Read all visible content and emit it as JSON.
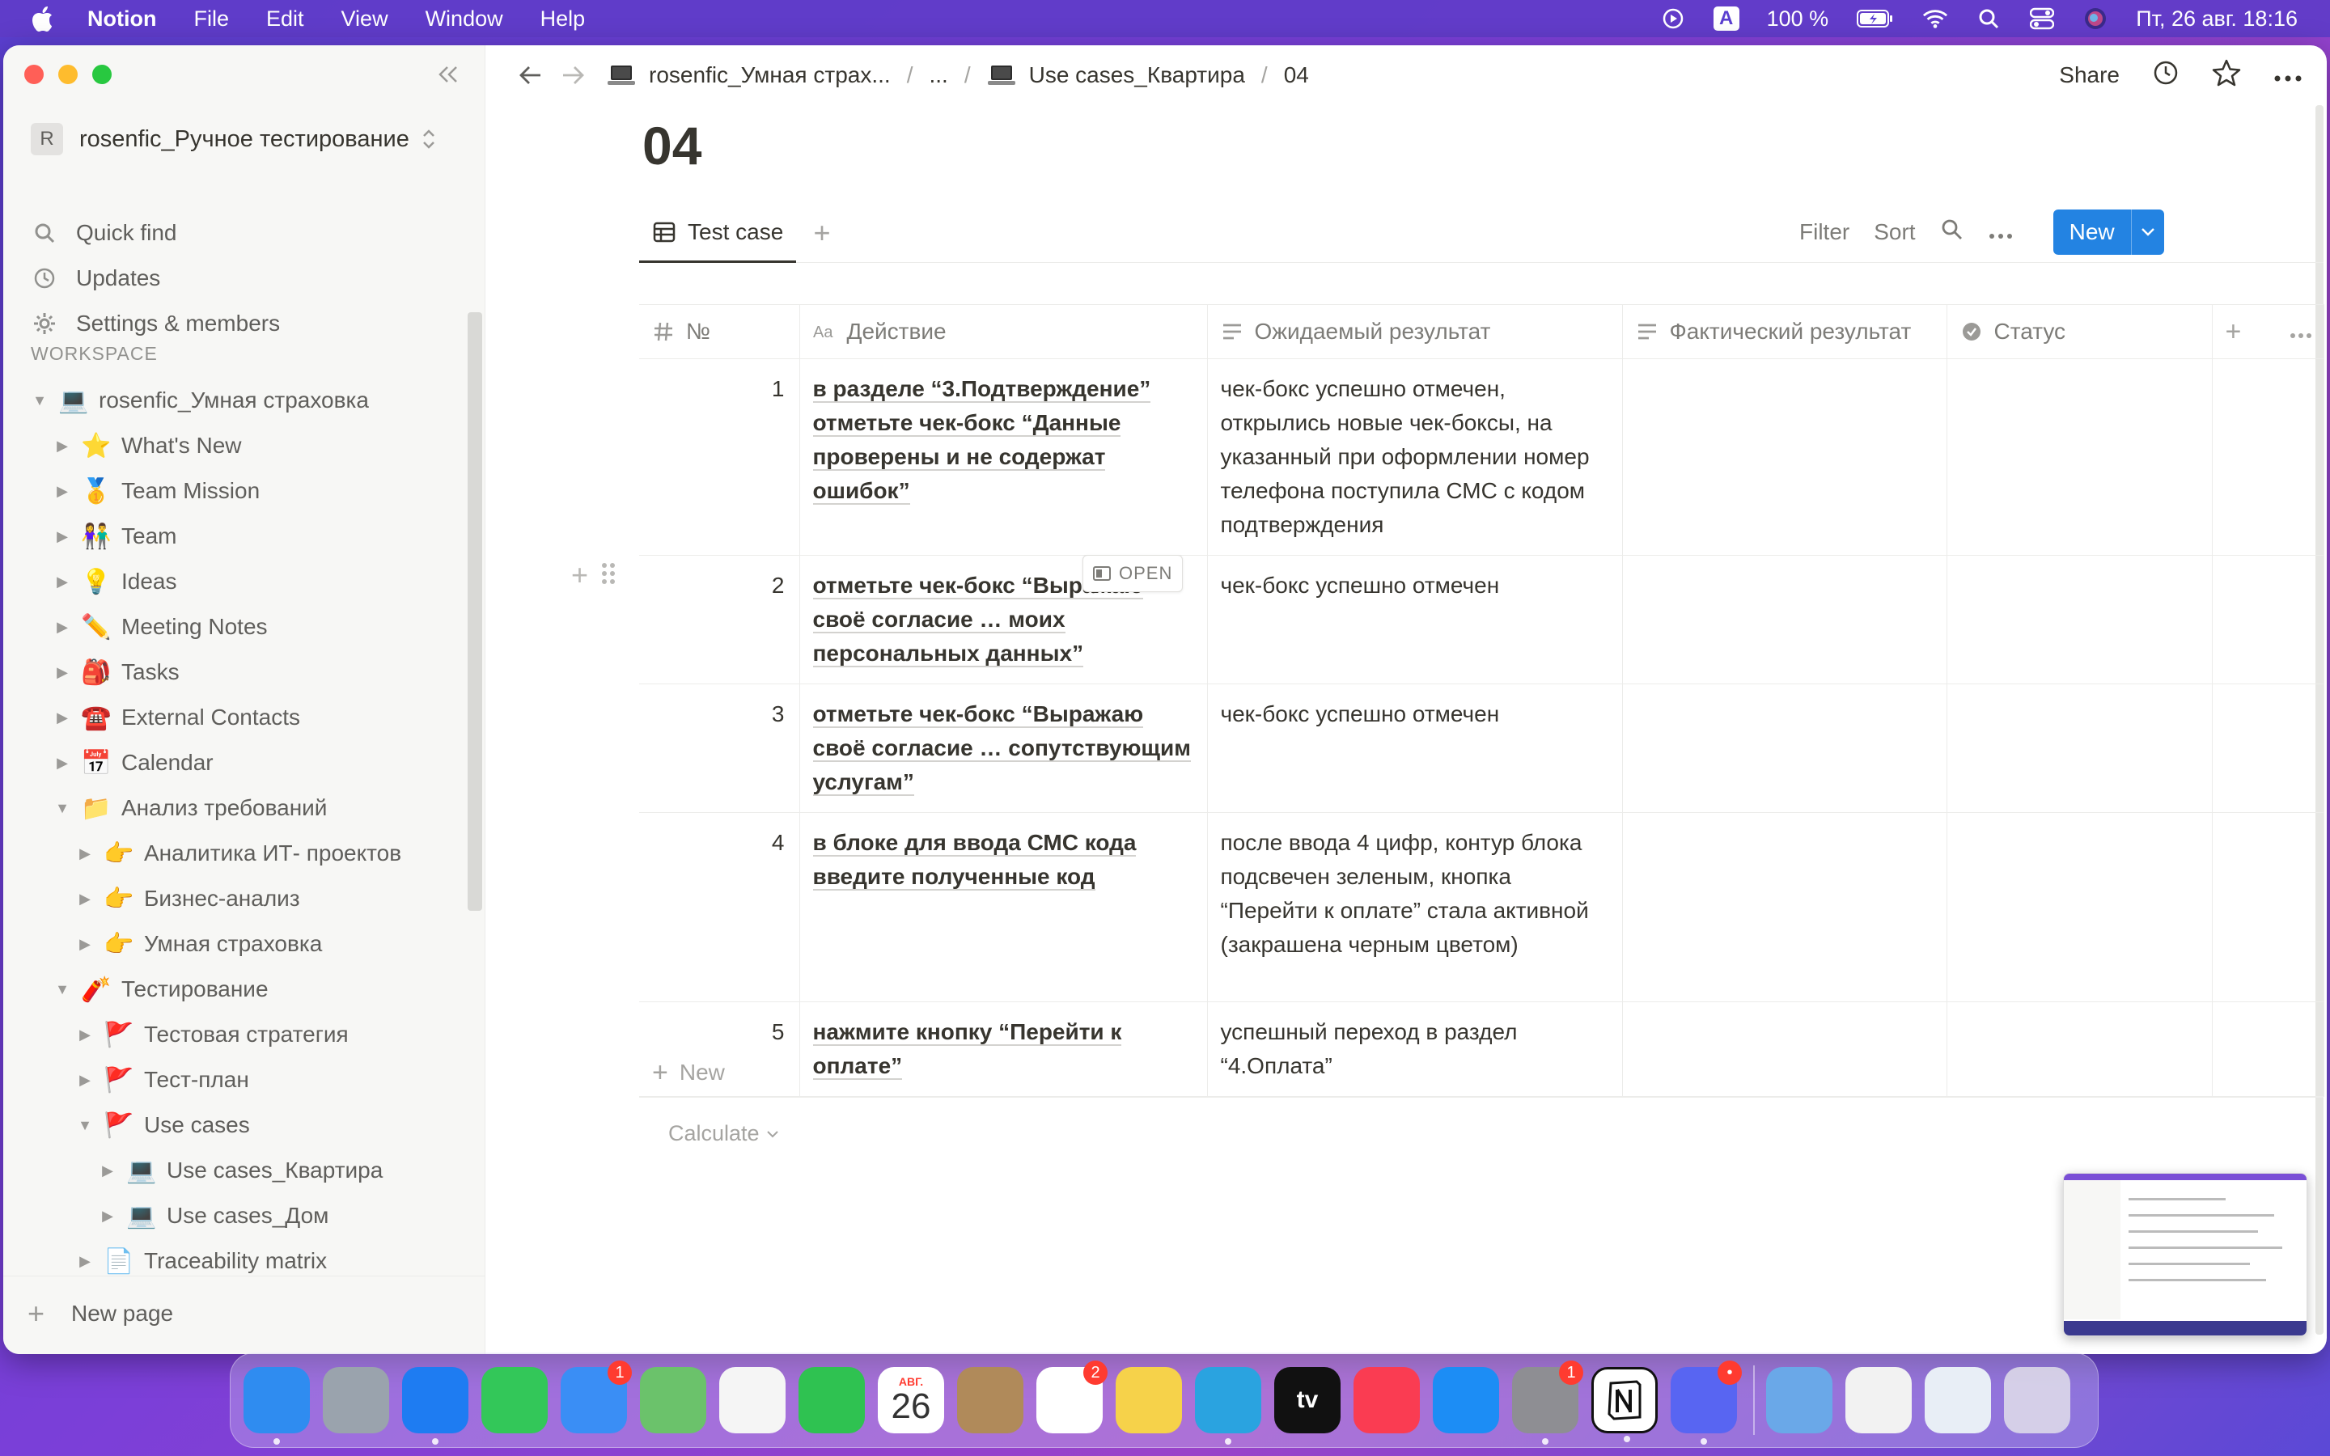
{
  "menubar": {
    "app_name": "Notion",
    "menus": [
      "File",
      "Edit",
      "View",
      "Window",
      "Help"
    ],
    "battery": "100 %",
    "datetime": "Пт, 26 авг.  18:16",
    "input_source": "A"
  },
  "sidebar": {
    "workspace_name": "rosenfic_Ручное тестирование",
    "workspace_initial": "R",
    "links": [
      "Quick find",
      "Updates",
      "Settings & members"
    ],
    "section_label": "WORKSPACE",
    "tree": [
      {
        "label": "rosenfic_Умная страховка",
        "icon": "💻",
        "depth": 0,
        "expanded": true
      },
      {
        "label": "What's New",
        "icon": "⭐",
        "depth": 1,
        "expanded": false
      },
      {
        "label": "Team Mission",
        "icon": "🥇",
        "depth": 1,
        "expanded": false
      },
      {
        "label": "Team",
        "icon": "👫",
        "depth": 1,
        "expanded": false
      },
      {
        "label": "Ideas",
        "icon": "💡",
        "depth": 1,
        "expanded": false
      },
      {
        "label": "Meeting Notes",
        "icon": "✏️",
        "depth": 1,
        "expanded": false
      },
      {
        "label": "Tasks",
        "icon": "🎒",
        "depth": 1,
        "expanded": false
      },
      {
        "label": "External Contacts",
        "icon": "☎️",
        "depth": 1,
        "expanded": false
      },
      {
        "label": "Calendar",
        "icon": "📅",
        "depth": 1,
        "expanded": false
      },
      {
        "label": "Анализ требований",
        "icon": "📁",
        "depth": 1,
        "expanded": true
      },
      {
        "label": "Аналитика ИТ- проектов",
        "icon": "👉",
        "depth": 2,
        "expanded": false
      },
      {
        "label": "Бизнес-анализ",
        "icon": "👉",
        "depth": 2,
        "expanded": false
      },
      {
        "label": "Умная страховка",
        "icon": "👉",
        "depth": 2,
        "expanded": false
      },
      {
        "label": "Тестирование",
        "icon": "🧨",
        "depth": 1,
        "expanded": true
      },
      {
        "label": "Тестовая стратегия",
        "icon": "🚩",
        "depth": 2,
        "expanded": false
      },
      {
        "label": "Тест-план",
        "icon": "🚩",
        "depth": 2,
        "expanded": false
      },
      {
        "label": "Use cases",
        "icon": "🚩",
        "depth": 2,
        "expanded": true
      },
      {
        "label": "Use cases_Квартира",
        "icon": "💻",
        "depth": 3,
        "expanded": false
      },
      {
        "label": "Use cases_Дом",
        "icon": "💻",
        "depth": 3,
        "expanded": false
      },
      {
        "label": "Traceability matrix",
        "icon": "📄",
        "depth": 2,
        "expanded": false
      }
    ],
    "new_page": "New page"
  },
  "topbar": {
    "breadcrumbs": [
      "rosenfic_Умная страх...",
      "...",
      "Use cases_Квартира",
      "04"
    ],
    "share": "Share"
  },
  "page": {
    "title": "04",
    "view_tab": "Test case",
    "actions": {
      "filter": "Filter",
      "sort": "Sort",
      "new": "New"
    },
    "columns": [
      "№",
      "Действие",
      "Ожидаемый результат",
      "Фактический результат",
      "Статус"
    ],
    "rows": [
      {
        "num": "1",
        "action": "в разделе “3.Подтверждение” отметьте чек-бокс “Данные проверены и не содержат ошибок”",
        "expected": "чек-бокс успешно отмечен, открылись новые чек-боксы, на указанный при оформлении номер телефона поступила СМС с кодом подтверждения",
        "actual": "",
        "status": ""
      },
      {
        "num": "2",
        "action": "отметьте чек-бокс “Выражаю своё согласие … моих персональных данных”",
        "expected": "чек-бокс успешно отмечен",
        "actual": "",
        "status": ""
      },
      {
        "num": "3",
        "action": "отметьте чек-бокс “Выражаю своё согласие … сопутствующим услугам”",
        "expected": "чек-бокс успешно отмечен",
        "actual": "",
        "status": ""
      },
      {
        "num": "4",
        "action": "в блоке для ввода СМС кода введите полученные код",
        "expected": "после ввода 4 цифр, контур блока подсвечен зеленым, кнопка “Перейти к оплате” стала активной (закрашена черным цветом)",
        "actual": "",
        "status": ""
      },
      {
        "num": "5",
        "action": "нажмите кнопку “Перейти к оплате”",
        "expected": "успешный переход в раздел “4.Оплата”",
        "actual": "",
        "status": ""
      }
    ],
    "open_chip": "OPEN",
    "add_row": "New",
    "calculate": "Calculate"
  },
  "dock": {
    "apps": [
      {
        "name": "Finder",
        "color": "#2f8cf0",
        "badge": "",
        "running": true
      },
      {
        "name": "Launchpad",
        "color": "#9aa3ad",
        "badge": "",
        "running": false
      },
      {
        "name": "Safari",
        "color": "#1e7cf2",
        "badge": "",
        "running": true
      },
      {
        "name": "Messages",
        "color": "#33c759",
        "badge": "",
        "running": false
      },
      {
        "name": "Mail",
        "color": "#3a8ef5",
        "badge": "1",
        "running": false
      },
      {
        "name": "Maps",
        "color": "#6bc26b",
        "badge": "",
        "running": false
      },
      {
        "name": "Photos",
        "color": "#f5f5f5",
        "badge": "",
        "running": false
      },
      {
        "name": "FaceTime",
        "color": "#2fc251",
        "badge": "",
        "running": false
      },
      {
        "name": "Calendar",
        "color": "#ffffff",
        "badge": "",
        "running": false
      },
      {
        "name": "Contacts",
        "color": "#b08a5a",
        "badge": "",
        "running": false
      },
      {
        "name": "Reminders",
        "color": "#ffffff",
        "badge": "2",
        "running": false
      },
      {
        "name": "Notes",
        "color": "#f6d24a",
        "badge": "",
        "running": false
      },
      {
        "name": "Telegram",
        "color": "#2aa3e0",
        "badge": "",
        "running": true
      },
      {
        "name": "Apple TV",
        "color": "#111111",
        "badge": "",
        "running": false
      },
      {
        "name": "Music",
        "color": "#fa3c52",
        "badge": "",
        "running": false
      },
      {
        "name": "App Store",
        "color": "#1c8df5",
        "badge": "",
        "running": false
      },
      {
        "name": "System Preferences",
        "color": "#8e8e93",
        "badge": "1",
        "running": true
      },
      {
        "name": "Notion",
        "color": "#ffffff",
        "badge": "",
        "running": true
      },
      {
        "name": "Discord",
        "color": "#5865f2",
        "badge": "•",
        "running": true
      }
    ],
    "calendar_month": "АВГ.",
    "calendar_day": "26",
    "tv_label": "tv",
    "folder_items": [
      "Downloads",
      "Recent document",
      "Recent document 2",
      "Trash"
    ]
  }
}
